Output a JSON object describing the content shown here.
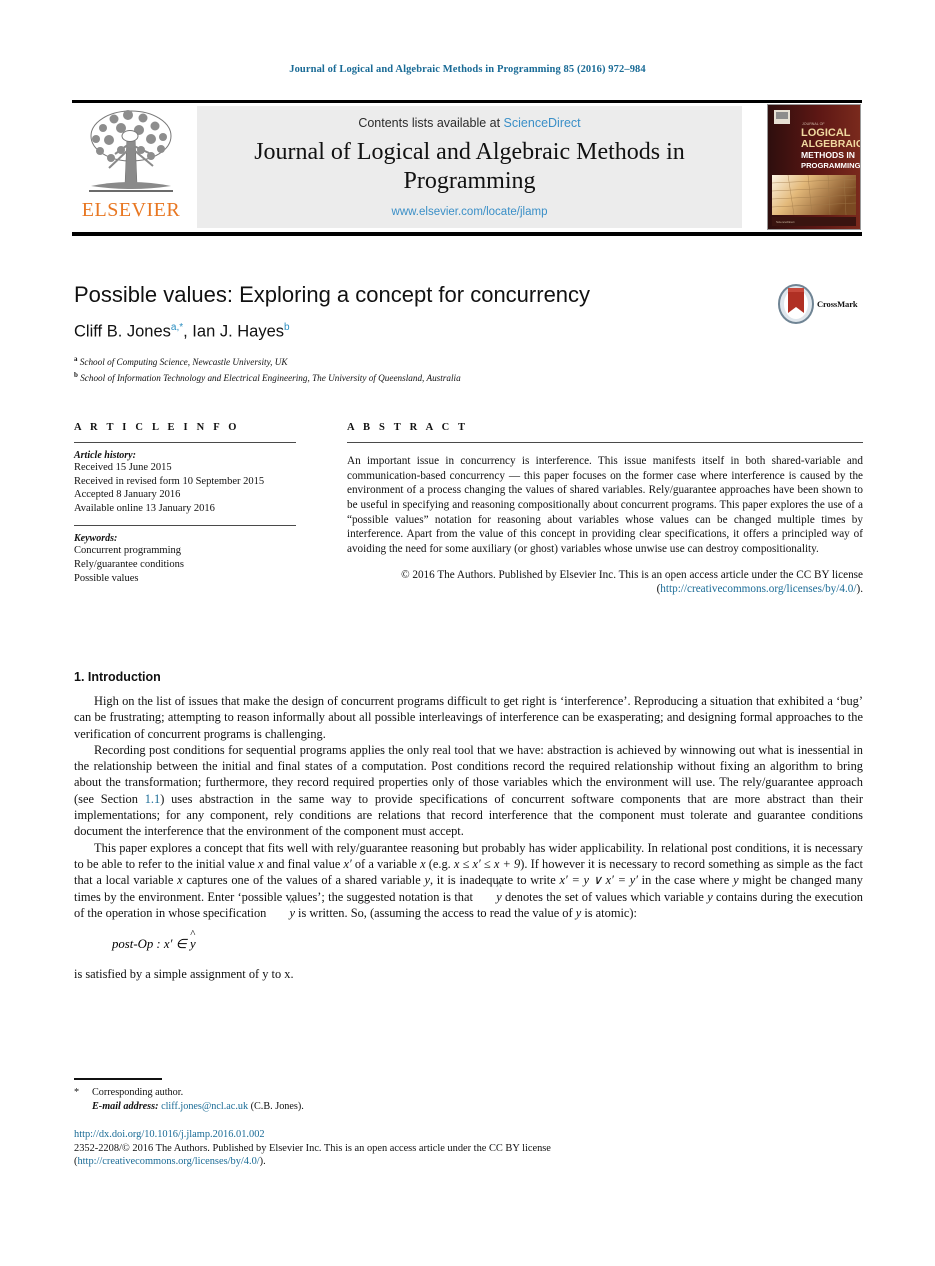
{
  "running_head": "Journal of Logical and Algebraic Methods in Programming 85 (2016) 972–984",
  "masthead": {
    "publisher": "ELSEVIER",
    "contents_prefix": "Contents lists available at ",
    "contents_link": "ScienceDirect",
    "journal_title": "Journal of Logical and Algebraic Methods in Programming",
    "journal_url": "www.elsevier.com/locate/jlamp",
    "cover_line1": "LOGICAL",
    "cover_line2": "ALGEBRAIC",
    "cover_line3": "METHODS IN",
    "cover_line4": "PROGRAMMING",
    "cover_kicker": "JOURNAL OF"
  },
  "article": {
    "title": "Possible values: Exploring a concept for concurrency",
    "authors_part1": "Cliff B. Jones",
    "authors_sup1": "a,*",
    "authors_part2": ", Ian J. Hayes",
    "authors_sup2": "b",
    "affiliation_a": "School of Computing Science, Newcastle University, UK",
    "affiliation_b": "School of Information Technology and Electrical Engineering, The University of Queensland, Australia",
    "crossmark_label": "CrossMark"
  },
  "info": {
    "heading": "A R T I C L E  I N F O",
    "history_label": "Article history:",
    "history": [
      "Received 15 June 2015",
      "Received in revised form 10 September 2015",
      "Accepted 8 January 2016",
      "Available online 13 January 2016"
    ],
    "keywords_label": "Keywords:",
    "keywords": [
      "Concurrent programming",
      "Rely/guarantee conditions",
      "Possible values"
    ]
  },
  "abstract": {
    "heading": "A B S T R A C T",
    "text": "An important issue in concurrency is interference. This issue manifests itself in both shared-variable and communication-based concurrency — this paper focuses on the former case where interference is caused by the environment of a process changing the values of shared variables. Rely/guarantee approaches have been shown to be useful in specifying and reasoning compositionally about concurrent programs. This paper explores the use of a “possible values” notation for reasoning about variables whose values can be changed multiple times by interference. Apart from the value of this concept in providing clear specifications, it offers a principled way of avoiding the need for some auxiliary (or ghost) variables whose unwise use can destroy compositionality.",
    "copyright_pre": "© 2016 The Authors. Published by Elsevier Inc. This is an open access article under the CC BY license (",
    "copyright_link": "http://creativecommons.org/licenses/by/4.0/",
    "copyright_post": ")."
  },
  "body": {
    "section_number_title": "1. Introduction",
    "p1": "High on the list of issues that make the design of concurrent programs difficult to get right is ‘interference’. Reproducing a situation that exhibited a ‘bug’ can be frustrating; attempting to reason informally about all possible interleavings of interference can be exasperating; and designing formal approaches to the verification of concurrent programs is challenging.",
    "p2a": "Recording post conditions for sequential programs applies the only real tool that we have: abstraction is achieved by winnowing out what is inessential in the relationship between the initial and final states of a computation. Post conditions record the required relationship without fixing an algorithm to bring about the transformation; furthermore, they record required properties only of those variables which the environment will use. The rely/guarantee approach (see Section ",
    "p2_ref": "1.1",
    "p2b": ") uses abstraction in the same way to provide specifications of concurrent software components that are more abstract than their implementations; for any component, rely conditions are relations that record interference that the component must tolerate and guarantee conditions document the interference that the environment of the component must accept.",
    "p3_s1": "This paper explores a concept that fits well with rely/guarantee reasoning but probably has wider applicability. In relational post conditions, it is necessary to be able to refer to the initial value ",
    "p3_x1": "x",
    "p3_s2": " and final value ",
    "p3_x2": "x′",
    "p3_s3": " of a variable ",
    "p3_x3": "x",
    "p3_s4": " (e.g. ",
    "p3_eq1": "x ≤ x′ ≤ x + 9",
    "p3_s5": "). If however it is necessary to record something as simple as the fact that a local variable ",
    "p3_x4": "x",
    "p3_s6": " captures one of the values of a shared variable ",
    "p3_y1": "y",
    "p3_s7": ", it is inadequate to write ",
    "p3_eq2": "x′ = y ∨ x′ = y′",
    "p3_s8": " in the case where ",
    "p3_y2": "y",
    "p3_s9": " might be changed many times by the environment. Enter ‘possible values’; the suggested notation is that ",
    "p3_yhat1": "y",
    "p3_s10": " denotes the set of values which variable ",
    "p3_y3": "y",
    "p3_s11": " contains during the execution of the operation in whose specification ",
    "p3_yhat2": "y",
    "p3_s12": " is written. So, (assuming the access to read the value of ",
    "p3_y4": "y",
    "p3_s13": " is atomic):",
    "formula_label": "post-Op",
    "formula_sep": " : ",
    "formula_lhs": "x′",
    "formula_op": " ∈ ",
    "formula_rhs": "y",
    "p4": "is satisfied by a simple assignment of y to x."
  },
  "footnotes": {
    "star": "*",
    "corresponding": "Corresponding author.",
    "email_label": "E-mail address:",
    "email": "cliff.jones@ncl.ac.uk",
    "email_attrib": "(C.B. Jones)."
  },
  "doi_block": {
    "doi": "http://dx.doi.org/10.1016/j.jlamp.2016.01.002",
    "issn_line_pre": "2352-2208/© 2016 The Authors. Published by Elsevier Inc. This is an open access article under the CC BY license",
    "issn_line_open": "(",
    "issn_link": "http://creativecommons.org/licenses/by/4.0/",
    "issn_line_close": ")."
  },
  "colors": {
    "link_blue": "#1a6b96",
    "sciencedirect_blue": "#3a8fc7",
    "elsevier_orange": "#E87722",
    "crossmark_red": "#b03024"
  }
}
